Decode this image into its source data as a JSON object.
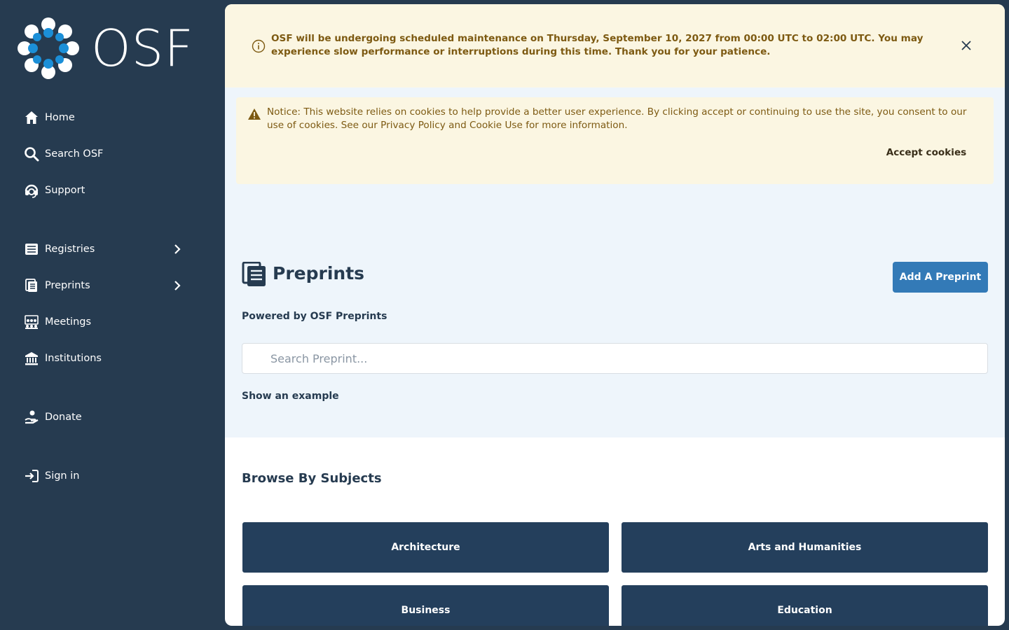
{
  "logo": {
    "text": "OSF"
  },
  "sidebar": {
    "items": [
      {
        "label": "Home",
        "icon": "home-icon"
      },
      {
        "label": "Search OSF",
        "icon": "search-icon"
      },
      {
        "label": "Support",
        "icon": "headset-icon"
      },
      {
        "label": "Registries",
        "icon": "list-icon",
        "has_submenu": true
      },
      {
        "label": "Preprints",
        "icon": "preprints-icon",
        "has_submenu": true
      },
      {
        "label": "Meetings",
        "icon": "meetings-icon"
      },
      {
        "label": "Institutions",
        "icon": "institution-icon"
      },
      {
        "label": "Donate",
        "icon": "donate-icon"
      },
      {
        "label": "Sign in",
        "icon": "sign-in-icon"
      }
    ]
  },
  "maintenance": {
    "text": "OSF will be undergoing scheduled maintenance on Thursday, September 10, 2027 from 00:00 UTC to 02:00 UTC. You may experience slow performance or interruptions during this time. Thank you for your patience.",
    "icon": "info-icon"
  },
  "cookie": {
    "text": "Notice: This website relies on cookies to help provide a better user experience. By clicking accept or continuing to use the site, you consent to our use of cookies. See our Privacy Policy and Cookie Use for more information.",
    "accept_label": "Accept cookies",
    "icon": "warning-icon"
  },
  "main": {
    "title": "Preprints",
    "add_button": "Add A Preprint",
    "powered_by": "Powered by OSF Preprints",
    "search_placeholder": "Search Preprint...",
    "show_example": "Show an example",
    "browse_title": "Browse By Subjects",
    "subjects": [
      "Architecture",
      "Arts and Humanities",
      "Business",
      "Education"
    ]
  },
  "colors": {
    "sidebar_bg": "#263b50",
    "banner_bg": "#fbf6e2",
    "hero_bg": "#eef5fb",
    "primary_button": "#337ab7",
    "subject_bg": "#243f5c"
  }
}
